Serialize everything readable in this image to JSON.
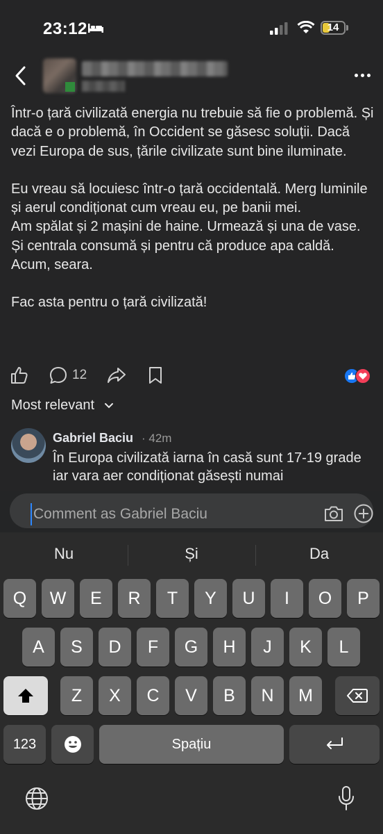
{
  "status": {
    "time": "23:12",
    "battery": "14",
    "battery_level": 0.14
  },
  "header": {
    "back_icon": "chevron-left-icon",
    "more_icon": "more-icon"
  },
  "post": {
    "paragraphs": [
      "Într-o țară civilizată energia nu trebuie să fie o problemă. Și dacă e o problemă, în Occident se găsesc soluții. Dacă vezi Europa de sus, țările civilizate sunt bine iluminate.",
      "Eu vreau să locuiesc într-o țară occidentală. Merg luminile și aerul condiționat cum vreau eu, pe banii mei.",
      "Am spălat și 2 mașini de haine. Urmează și una de vase. Și centrala consumă și pentru că produce apa caldă. Acum, seara.",
      "Fac asta pentru o țară civilizată!"
    ]
  },
  "actions": {
    "comment_count": "12"
  },
  "sort": {
    "label": "Most relevant"
  },
  "comment": {
    "author": "Gabriel Baciu",
    "time": "· 42m",
    "text": "În Europa civilizată iarna în casă sunt 17-19 grade iar vara aer condiționat găsești numai"
  },
  "composer": {
    "placeholder": "Comment as Gabriel Baciu"
  },
  "keyboard": {
    "suggestions": [
      "Nu",
      "Și",
      "Da"
    ],
    "row1": [
      "Q",
      "W",
      "E",
      "R",
      "T",
      "Y",
      "U",
      "I",
      "O",
      "P"
    ],
    "row2": [
      "A",
      "S",
      "D",
      "F",
      "G",
      "H",
      "J",
      "K",
      "L"
    ],
    "row3": [
      "Z",
      "X",
      "C",
      "V",
      "B",
      "N",
      "M"
    ],
    "numbers_key": "123",
    "space_key": "Spațiu"
  }
}
